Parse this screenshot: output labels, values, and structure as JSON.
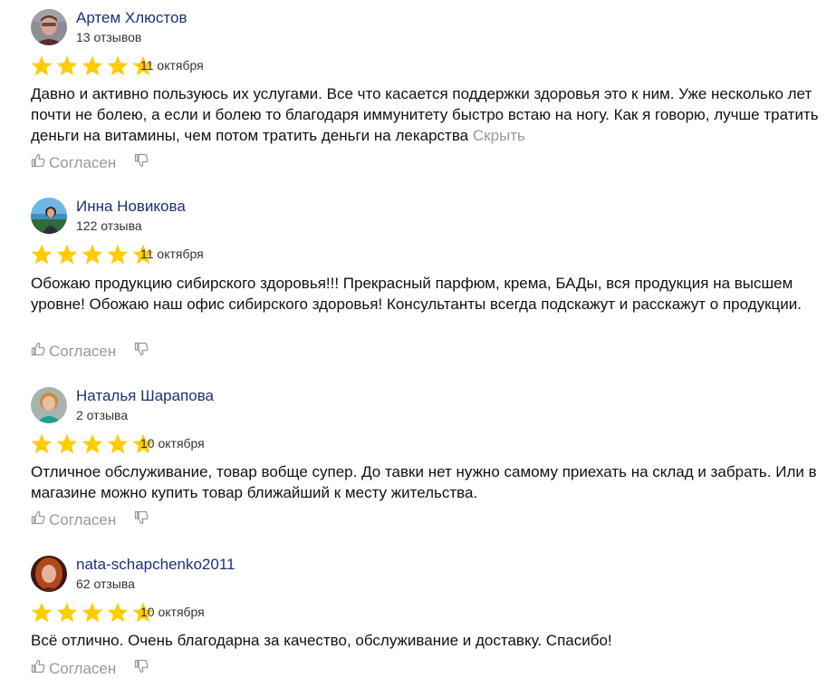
{
  "reviews": [
    {
      "author": "Артем Хлюстов",
      "count": "13 отзывов",
      "rating": 5,
      "date": "11 октября",
      "text": "Давно и активно пользуюсь их услугами. Все что касается поддержки здоровья это к ним. Уже несколько лет почти не болею, а если и болею то благодаря иммунитету быстро встаю на ногу. Как я говорю, лучше тратить деньги на витамины, чем потом тратить деньги на лекарства",
      "hide_label": "Скрыть",
      "agree_label": "Согласен"
    },
    {
      "author": "Инна Новикова",
      "count": "122 отзыва",
      "rating": 5,
      "date": "11 октября",
      "text": "Обожаю продукцию сибирского здоровья!!! Прекрасный парфюм, крема, БАДы, вся продукция на высшем уровне! Обожаю наш офис сибирского здоровья! Консультанты всегда подскажут и расскажут о продукции.",
      "agree_label": "Согласен"
    },
    {
      "author": "Наталья Шарапова",
      "count": "2 отзыва",
      "rating": 5,
      "date": "10 октября",
      "text": "Отличное обслуживание, товар вобще супер. До тавки нет нужно самому приехать на склад и забрать. Или в магазине можно купить товар ближайший к месту жительства.",
      "agree_label": "Согласен"
    },
    {
      "author": "nata-schapchenko2011",
      "count": "62 отзыва",
      "rating": 5,
      "date": "10 октября",
      "text": "Всё отлично. Очень благодарна за качество, обслуживание и доставку. Спасибо!",
      "agree_label": "Согласен"
    }
  ],
  "colors": {
    "star": "#ffcc00",
    "author": "#1f2f7a",
    "muted": "#999999"
  }
}
